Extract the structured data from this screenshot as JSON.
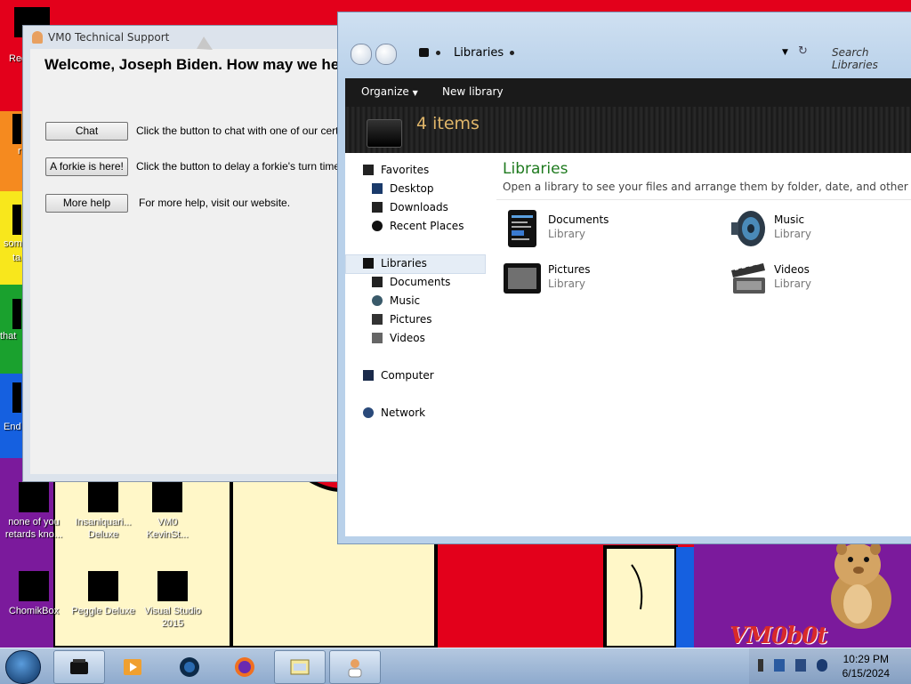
{
  "wallpaper": {
    "watermark": "VM0b0t"
  },
  "desktop": {
    "edge_labels": [
      "Rec",
      "r",
      "som",
      "ta",
      "that",
      "End"
    ],
    "icons": [
      {
        "label_1": "none of you",
        "label_2": "retards kno..."
      },
      {
        "label_1": "Insaniquari...",
        "label_2": "Deluxe"
      },
      {
        "label_1": "VM0",
        "label_2": "KevinSt..."
      },
      {
        "label_1": "ChomikBox",
        "label_2": ""
      },
      {
        "label_1": "Peggle Deluxe",
        "label_2": ""
      },
      {
        "label_1": "Visual Studio",
        "label_2": "2015"
      }
    ]
  },
  "support_window": {
    "title": "VM0 Technical Support",
    "welcome": "Welcome, Joseph Biden. How may we hel",
    "rows": [
      {
        "button": "Chat",
        "desc": "Click the button to chat with one of our certified"
      },
      {
        "button": "A forkie is here!",
        "desc": "Click the button to delay a forkie's turn time."
      },
      {
        "button": "More help",
        "desc": "For more help, visit our website."
      }
    ]
  },
  "explorer": {
    "breadcrumb": "Libraries",
    "search_placeholder": "Search Libraries",
    "toolbar": {
      "organize": "Organize",
      "new_library": "New library"
    },
    "item_count": "4 items",
    "nav": {
      "favorites": "Favorites",
      "desktop": "Desktop",
      "downloads": "Downloads",
      "recent_places": "Recent Places",
      "libraries": "Libraries",
      "documents": "Documents",
      "music": "Music",
      "pictures": "Pictures",
      "videos": "Videos",
      "computer": "Computer",
      "network": "Network"
    },
    "pane_title": "Libraries",
    "pane_subtitle": "Open a library to see your files and arrange them by folder, date, and other properties.",
    "libraries": [
      {
        "name": "Documents",
        "kind": "Library",
        "icon": "documents-library-icon"
      },
      {
        "name": "Music",
        "kind": "Library",
        "icon": "music-library-icon"
      },
      {
        "name": "Pictures",
        "kind": "Library",
        "icon": "pictures-library-icon"
      },
      {
        "name": "Videos",
        "kind": "Library",
        "icon": "videos-library-icon"
      }
    ]
  },
  "taskbar": {
    "buttons": [
      "explorer-icon",
      "media-player-icon",
      "app-globe-icon",
      "firefox-icon",
      "control-panel-icon",
      "support-agent-icon"
    ],
    "time": "10:29 PM",
    "date": "6/15/2024"
  }
}
